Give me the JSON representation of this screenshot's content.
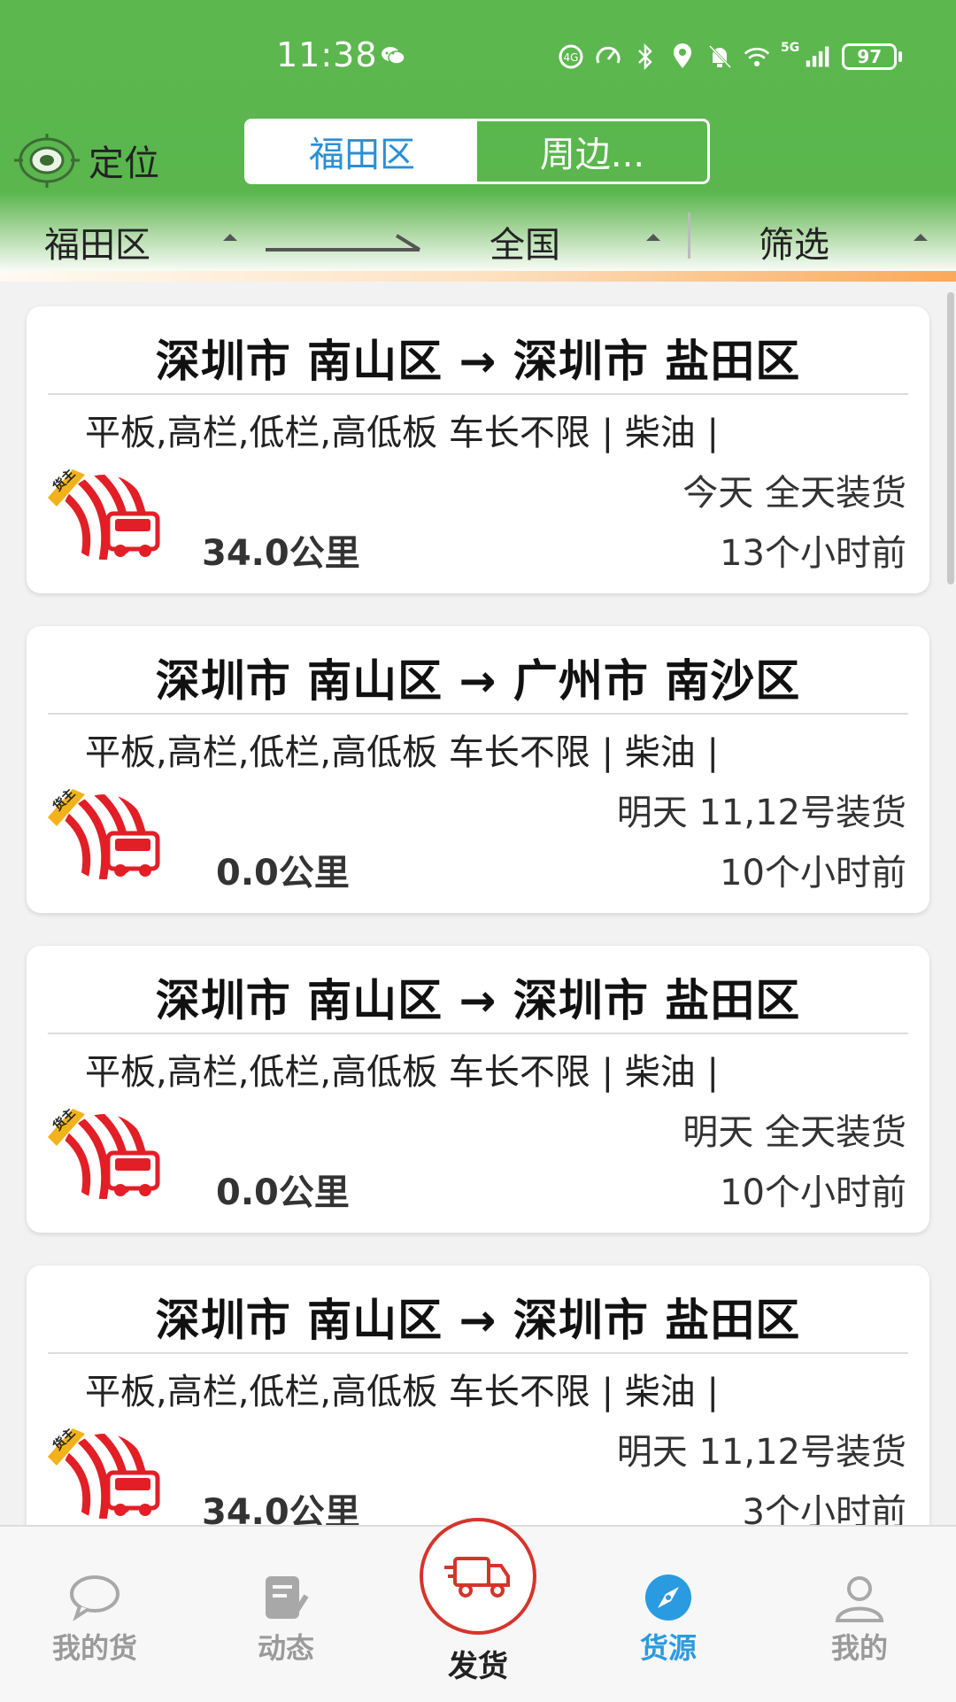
{
  "status_bar": {
    "time": "11:38",
    "battery": "97",
    "network": "5G",
    "icons": [
      "wechat-icon",
      "hd-call-icon",
      "speed-icon",
      "bluetooth-icon",
      "location-pin-icon",
      "mute-bell-icon",
      "wifi-icon",
      "signal-icon",
      "battery-icon"
    ]
  },
  "header": {
    "location_label": "定位",
    "tabs": [
      {
        "label": "福田区",
        "active": true
      },
      {
        "label": "周边...",
        "active": false
      }
    ],
    "filters": {
      "origin": "福田区",
      "destination": "全国",
      "filter": "筛选"
    }
  },
  "cards": [
    {
      "route": "深圳市 南山区 → 深圳市 盐田区",
      "spec": "平板,高栏,低栏,高低板 车长不限 | 柴油 |",
      "load": "今天 全天装货",
      "distance": "34.0公里",
      "time_ago": "13个小时前",
      "badge": "货主"
    },
    {
      "route": "深圳市 南山区 → 广州市 南沙区",
      "spec": "平板,高栏,低栏,高低板 车长不限 | 柴油 |",
      "load": "明天 11,12号装货",
      "distance": "0.0公里",
      "time_ago": "10个小时前",
      "badge": "货主"
    },
    {
      "route": "深圳市 南山区 → 深圳市 盐田区",
      "spec": "平板,高栏,低栏,高低板 车长不限 | 柴油 |",
      "load": "明天 全天装货",
      "distance": "0.0公里",
      "time_ago": "10个小时前",
      "badge": "货主"
    },
    {
      "route": "深圳市 南山区 → 深圳市 盐田区",
      "spec": "平板,高栏,低栏,高低板 车长不限 | 柴油 |",
      "load": "明天 11,12号装货",
      "distance": "34.0公里",
      "time_ago": "3个小时前",
      "badge": "货主"
    }
  ],
  "bottom_nav": {
    "items": [
      {
        "label": "我的货",
        "icon": "chat-bubble-icon",
        "active": false
      },
      {
        "label": "动态",
        "icon": "edit-doc-icon",
        "active": false
      },
      {
        "label": "发货",
        "icon": "truck-icon",
        "active": false
      },
      {
        "label": "货源",
        "icon": "compass-icon",
        "active": true
      },
      {
        "label": "我的",
        "icon": "person-icon",
        "active": false
      }
    ]
  },
  "colors": {
    "header_green": "#5cb74f",
    "active_blue": "#2a9be0",
    "brand_red": "#d6342b",
    "badge_gold": "#f2b21c"
  }
}
